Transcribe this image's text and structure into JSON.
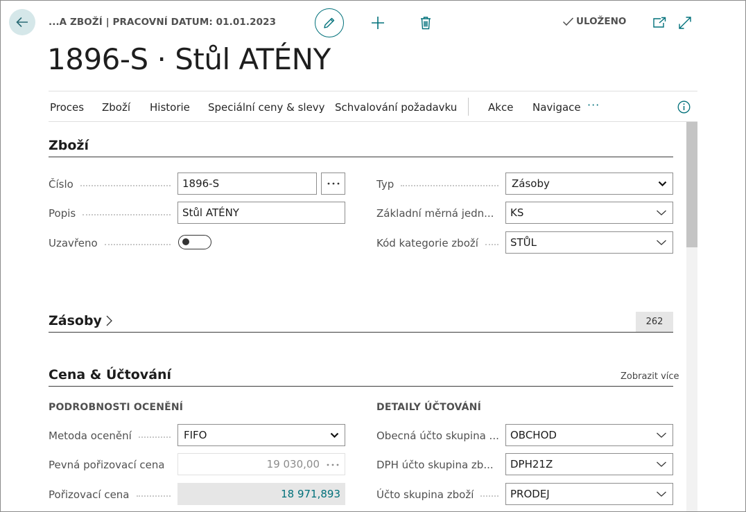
{
  "header": {
    "breadcrumb": "...A ZBOŽÍ | PRACOVNÍ DATUM: 01.01.2023",
    "status": "ULOŽENO",
    "title": "1896-S · Stůl ATÉNY"
  },
  "icons": {
    "back": "arrow-left-icon",
    "edit": "pencil-icon",
    "new": "plus-icon",
    "delete": "trash-icon",
    "saved": "checkmark-icon",
    "open_new": "open-in-new-window-icon",
    "expand": "expand-icon",
    "info": "info-icon"
  },
  "action_bar": {
    "items": [
      "Proces",
      "Zboží",
      "Historie",
      "Speciální ceny & slevy",
      "Schvalování požadavku",
      "Akce",
      "Navigace"
    ],
    "more": "···"
  },
  "sections": {
    "item": {
      "title": "Zboží",
      "fields": {
        "number": {
          "label": "Číslo",
          "value": "1896-S"
        },
        "description": {
          "label": "Popis",
          "value": "Stůl ATÉNY"
        },
        "blocked": {
          "label": "Uzavřeno",
          "value": false
        },
        "type": {
          "label": "Typ",
          "value": "Zásoby"
        },
        "base_uom": {
          "label": "Základní měrná jedn...",
          "value": "KS"
        },
        "category": {
          "label": "Kód kategorie zboží",
          "value": "STŮL"
        }
      }
    },
    "inventory": {
      "title": "Zásoby",
      "badge": "262"
    },
    "price": {
      "title": "Cena & Účtování",
      "show_more": "Zobrazit více",
      "left_header": "PODROBNOSTI OCENĚNÍ",
      "right_header": "DETAILY ÚČTOVÁNÍ",
      "fields": {
        "costing_method": {
          "label": "Metoda ocenění",
          "value": "FIFO"
        },
        "standard_cost": {
          "label": "Pevná pořizovací cena",
          "value": "19 030,00"
        },
        "unit_cost": {
          "label": "Pořizovací cena",
          "value": "18 971,893"
        },
        "gen_prod_posting": {
          "label": "Obecná účto skupina ...",
          "value": "OBCHOD"
        },
        "vat_prod_posting": {
          "label": "DPH účto skupina zb...",
          "value": "DPH21Z"
        },
        "inventory_posting": {
          "label": "Účto skupina zboží",
          "value": "PRODEJ"
        }
      }
    }
  },
  "colors": {
    "accent": "#00707a",
    "back_button_bg": "#d5e7e9",
    "field_border": "#8d8d8d",
    "scroll_thumb": "#c4c4c4"
  }
}
